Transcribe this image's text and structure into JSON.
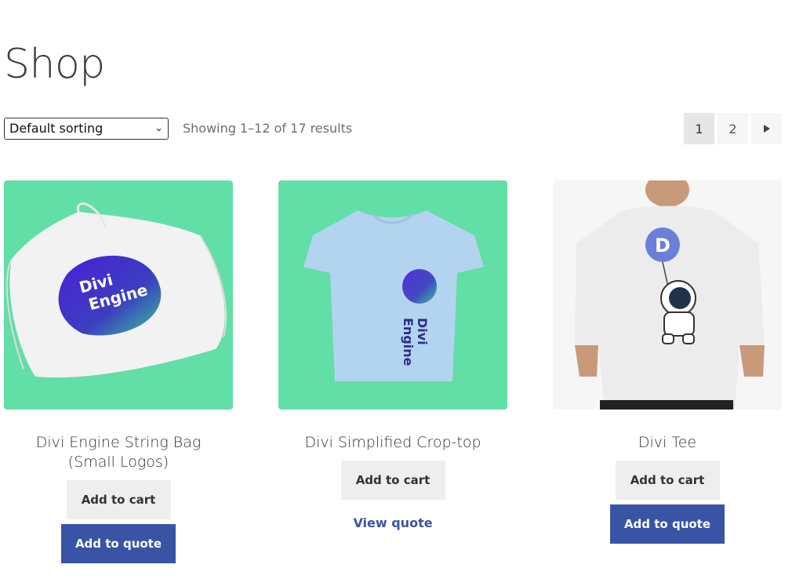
{
  "page": {
    "title": "Shop"
  },
  "toolbar": {
    "sorting_value": "Default sorting",
    "result_count": "Showing 1–12 of 17 results",
    "pagination": {
      "pages": [
        "1",
        "2"
      ],
      "current": "1",
      "next_icon": "arrow-right-icon"
    }
  },
  "colors": {
    "accent": "#3a54a5",
    "mint": "#62dea7",
    "light_button": "#eeeeee"
  },
  "products": [
    {
      "title": "Divi Engine String Bag (Small Logos)",
      "image": "drawstring-bag-image",
      "logo_line1": "Divi",
      "logo_line2": "Engine",
      "add_to_cart": "Add to cart",
      "quote_action": "Add to quote"
    },
    {
      "title": "Divi Simplified Crop-top",
      "image": "blue-tshirt-image",
      "logo_line1": "Divi",
      "logo_line2": "Engine",
      "add_to_cart": "Add to cart",
      "quote_action": "View quote"
    },
    {
      "title": "Divi Tee",
      "image": "astronaut-tshirt-image",
      "balloon_letter": "D",
      "add_to_cart": "Add to cart",
      "quote_action": "Add to quote"
    }
  ]
}
